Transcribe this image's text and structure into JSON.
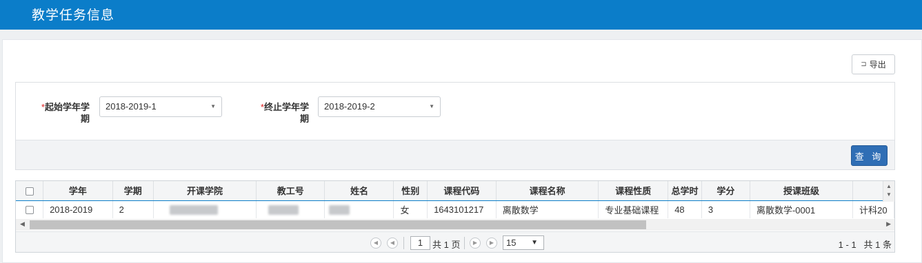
{
  "header": {
    "title": "教学任务信息"
  },
  "toolbar": {
    "export_label": "导出",
    "export_icon": "export-icon"
  },
  "filters": {
    "start_label": "起始学年学期",
    "start_value": "2018-2019-1",
    "end_label": "终止学年学期",
    "end_value": "2018-2019-2",
    "required_mark": "*",
    "query_label": "查 询"
  },
  "table": {
    "columns": [
      "学年",
      "学期",
      "开课学院",
      "教工号",
      "姓名",
      "性别",
      "课程代码",
      "课程名称",
      "课程性质",
      "总学时",
      "学分",
      "授课班级"
    ],
    "rows": [
      {
        "year": "2018-2019",
        "term": "2",
        "college": "",
        "staff_id": "",
        "name": "",
        "gender": "女",
        "course_code": "1643101217",
        "course_name": "离散数学",
        "course_type": "专业基础课程",
        "total_hours": "48",
        "credits": "3",
        "class": "离散数学-0001",
        "extra": "计科20"
      }
    ]
  },
  "pager": {
    "current_page": "1",
    "total_pages_text": "共 1 页",
    "page_size": "15",
    "range_text": "1 - 1",
    "total_text": "共 1 条"
  },
  "colors": {
    "header_bg": "#0b7dc9",
    "primary_button": "#2f6eb5",
    "required": "#e02020"
  }
}
